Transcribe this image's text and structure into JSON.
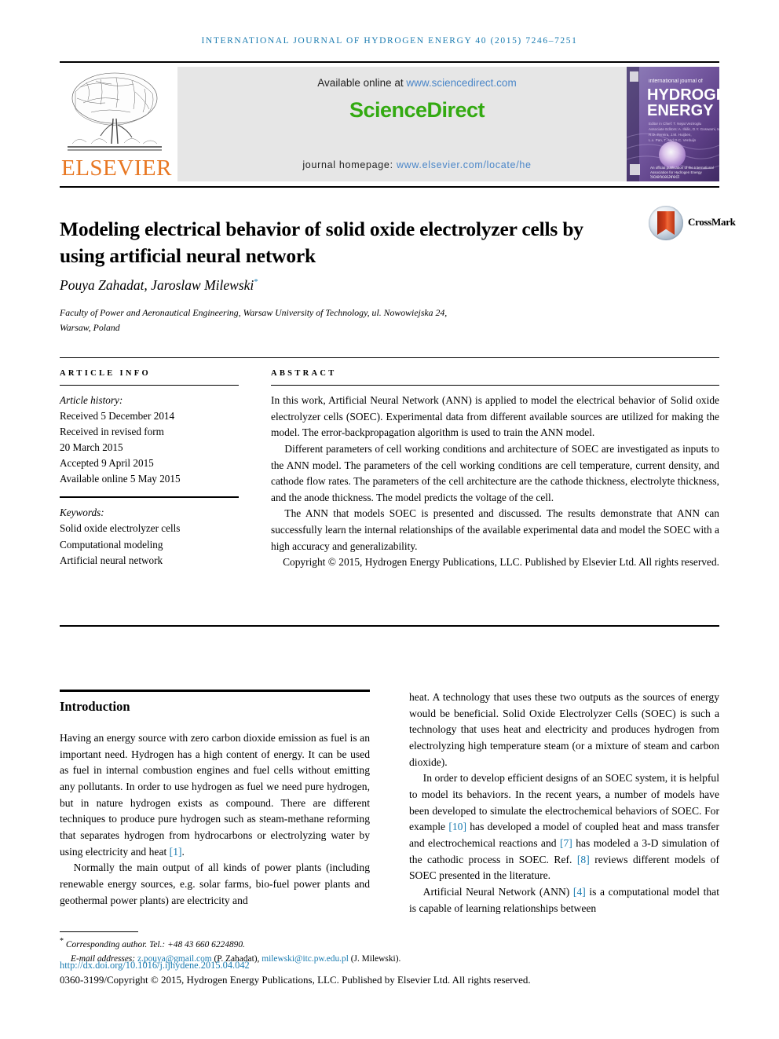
{
  "running_head": "International Journal of Hydrogen Energy 40 (2015) 7246–7251",
  "masthead": {
    "publisher": "ELSEVIER",
    "available_prefix": "Available online at ",
    "available_url": "www.sciencedirect.com",
    "sciencedirect_logo": "ScienceDirect",
    "homepage_prefix": "journal homepage: ",
    "homepage_url": "www.elsevier.com/locate/he",
    "cover_line1": "international journal of",
    "cover_line2": "HYDROGEN",
    "cover_line3": "ENERGY",
    "band_color": "#e6e6e6",
    "elsevier_orange": "#e87722",
    "sciencedirect_green": "#33aa11",
    "link_blue": "#4a86c8"
  },
  "crossmark": {
    "label": "CrossMark"
  },
  "article": {
    "title": "Modeling electrical behavior of solid oxide electrolyzer cells by using artificial neural network",
    "authors": "Pouya Zahadat, Jaroslaw Milewski",
    "author_star": "*",
    "affiliation_line1": "Faculty of Power and Aeronautical Engineering, Warsaw University of Technology, ul. Nowowiejska 24,",
    "affiliation_line2": "Warsaw, Poland"
  },
  "article_info": {
    "heading": "ARTICLE INFO",
    "history_label": "Article history:",
    "history": [
      "Received 5 December 2014",
      "Received in revised form",
      "20 March 2015",
      "Accepted 9 April 2015",
      "Available online 5 May 2015"
    ],
    "keywords_label": "Keywords:",
    "keywords": [
      "Solid oxide electrolyzer cells",
      "Computational modeling",
      "Artificial neural network"
    ]
  },
  "abstract": {
    "heading": "ABSTRACT",
    "p1": "In this work, Artificial Neural Network (ANN) is applied to model the electrical behavior of Solid oxide electrolyzer cells (SOEC). Experimental data from different available sources are utilized for making the model. The error-backpropagation algorithm is used to train the ANN model.",
    "p2": "Different parameters of cell working conditions and architecture of SOEC are investigated as inputs to the ANN model. The parameters of the cell working conditions are cell temperature, current density, and cathode flow rates. The parameters of the cell architecture are the cathode thickness, electrolyte thickness, and the anode thickness. The model predicts the voltage of the cell.",
    "p3": "The ANN that models SOEC is presented and discussed. The results demonstrate that ANN can successfully learn the internal relationships of the available experimental data and model the SOEC with a high accuracy and generalizability.",
    "copyright": "Copyright © 2015, Hydrogen Energy Publications, LLC. Published by Elsevier Ltd. All rights reserved."
  },
  "introduction": {
    "heading": "Introduction",
    "left_p1": "Having an energy source with zero carbon dioxide emission as fuel is an important need. Hydrogen has a high content of energy. It can be used as fuel in internal combustion engines and fuel cells without emitting any pollutants. In order to use hydrogen as fuel we need pure hydrogen, but in nature hydrogen exists as compound. There are different techniques to produce pure hydrogen such as steam-methane reforming that separates hydrogen from hydrocarbons or electrolyzing water by using electricity and heat ",
    "left_p1_ref": "[1]",
    "left_p1_tail": ".",
    "left_p2": "Normally the main output of all kinds of power plants (including renewable energy sources, e.g. solar farms, bio-fuel power plants and geothermal power plants) are electricity and",
    "right_p1": "heat. A technology that uses these two outputs as the sources of energy would be beneficial. Solid Oxide Electrolyzer Cells (SOEC) is such a technology that uses heat and electricity and produces hydrogen from electrolyzing high temperature steam (or a mixture of steam and carbon dioxide).",
    "right_p2_a": "In order to develop efficient designs of an SOEC system, it is helpful to model its behaviors. In the recent years, a number of models have been developed to simulate the electrochemical behaviors of SOEC. For example ",
    "right_p2_ref1": "[10]",
    "right_p2_b": " has developed a model of coupled heat and mass transfer and electrochemical reactions and ",
    "right_p2_ref2": "[7]",
    "right_p2_c": " has modeled a 3-D simulation of the cathodic process in SOEC. Ref. ",
    "right_p2_ref3": "[8]",
    "right_p2_d": " reviews different models of SOEC presented in the literature.",
    "right_p3_a": "Artificial Neural Network (ANN) ",
    "right_p3_ref": "[4]",
    "right_p3_b": " is a computational model that is capable of learning relationships between"
  },
  "footer": {
    "corresponding_star": "*",
    "corresponding": " Corresponding author. Tel.: +48 43 660 6224890.",
    "email_label": "E-mail addresses: ",
    "email1": "z.pouya@gmail.com",
    "email1_name": " (P. Zahadat), ",
    "email2": "milewski@itc.pw.edu.pl",
    "email2_name": " (J. Milewski).",
    "doi": "http://dx.doi.org/10.1016/j.ijhydene.2015.04.042",
    "issn_line": "0360-3199/Copyright © 2015, Hydrogen Energy Publications, LLC. Published by Elsevier Ltd. All rights reserved.",
    "link_color": "#1a7bb0"
  }
}
